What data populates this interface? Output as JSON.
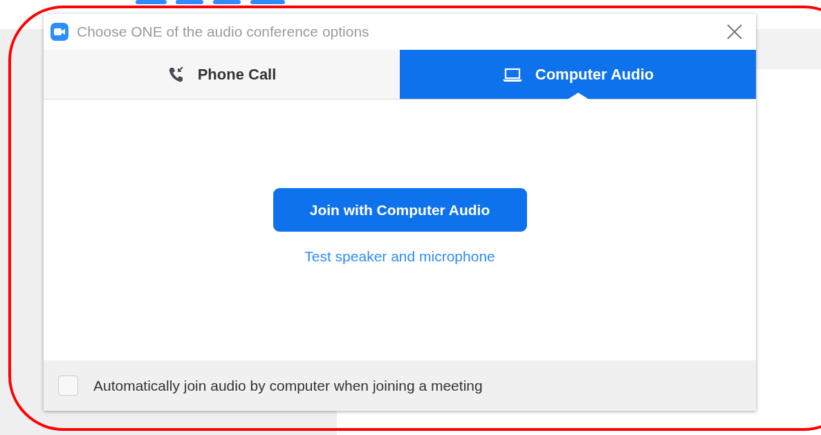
{
  "window": {
    "title": "Choose ONE of the audio conference options"
  },
  "tabs": [
    {
      "label": "Phone Call",
      "kind": "phone",
      "selected": false
    },
    {
      "label": "Computer Audio",
      "kind": "computer",
      "selected": true
    }
  ],
  "join_button": "Join with Computer Audio",
  "test_link": "Test speaker and microphone",
  "auto_join": {
    "label": "Automatically join audio by computer when joining a meeting",
    "checked": false
  }
}
